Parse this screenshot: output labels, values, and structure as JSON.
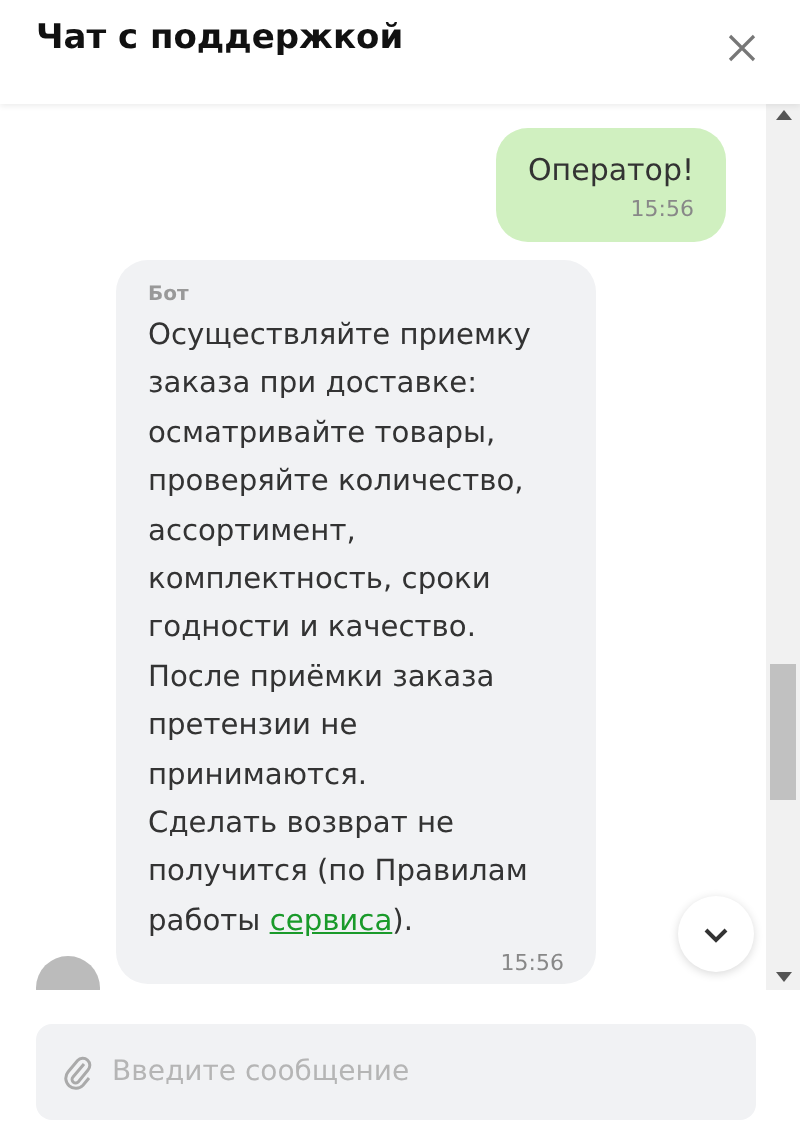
{
  "header": {
    "title": "Чат с поддержкой"
  },
  "messages": [
    {
      "kind": "outgoing",
      "text": "Оператор!",
      "time": "15:56"
    },
    {
      "kind": "incoming",
      "sender": "Бот",
      "lines": [
        "Осуществляйте приемку",
        "заказа при доставке:",
        "осматривайте товары,",
        "проверяйте количество,",
        "ассортимент,",
        "комплектность, сроки",
        "годности и качество.",
        "После приёмки заказа",
        "претензии не",
        "принимаются.",
        "Сделать возврат не",
        "получится (по Правилам"
      ],
      "link_line": {
        "before": "работы ",
        "link": "сервиса",
        "after": ")."
      },
      "time": "15:56"
    }
  ],
  "composer": {
    "placeholder": "Введите сообщение"
  }
}
